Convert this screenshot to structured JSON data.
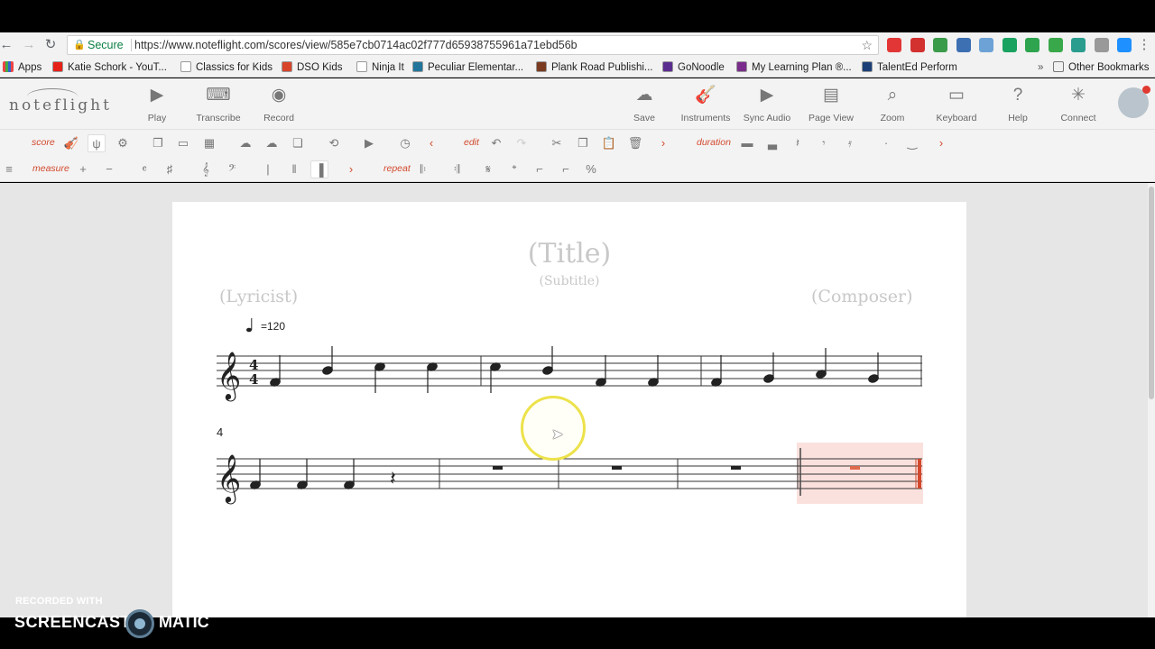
{
  "browser": {
    "secure_label": "Secure",
    "url": "https://www.noteflight.com/scores/view/585e7cb0714ac02f777d65938755961a71ebd56b",
    "apps_label": "Apps",
    "other_bookmarks": "Other Bookmarks",
    "overflow": "»",
    "bookmarks": [
      {
        "label": "Katie Schork - YouT...",
        "color": "#e62117"
      },
      {
        "label": "Classics for Kids",
        "color": "#ffffff"
      },
      {
        "label": "DSO Kids",
        "color": "#d8442a"
      },
      {
        "label": "Ninja It",
        "color": "#ffffff"
      },
      {
        "label": "Peculiar Elementar...",
        "color": "#21759b"
      },
      {
        "label": "Plank Road Publishi...",
        "color": "#7a3b20"
      },
      {
        "label": "GoNoodle",
        "color": "#5b2d8e"
      },
      {
        "label": "My Learning Plan ®...",
        "color": "#7a2c8c"
      },
      {
        "label": "TalentEd Perform",
        "color": "#1c3f77"
      }
    ],
    "extensions": [
      "#e23636",
      "#d33030",
      "#3a9b4a",
      "#3d6fb3",
      "#6da2d6",
      "#1aa260",
      "#2ea44f",
      "#38a84a",
      "#2a9d8f",
      "#999999",
      "#1e90ff"
    ]
  },
  "app": {
    "logo": "noteflight",
    "header_buttons": [
      {
        "label": "Play",
        "icon": "play-icon",
        "glyph": "▶"
      },
      {
        "label": "Transcribe",
        "icon": "keyboard-transcribe-icon",
        "glyph": "⌨"
      },
      {
        "label": "Record",
        "icon": "record-icon",
        "glyph": "◉"
      },
      {
        "label": "Save",
        "icon": "cloud-save-icon",
        "glyph": "☁"
      },
      {
        "label": "Instruments",
        "icon": "guitar-icon",
        "glyph": "🎸"
      },
      {
        "label": "Sync Audio",
        "icon": "sync-audio-icon",
        "glyph": "▶"
      },
      {
        "label": "Page View",
        "icon": "page-icon",
        "glyph": "▤"
      },
      {
        "label": "Zoom",
        "icon": "zoom-icon",
        "glyph": "⌕"
      },
      {
        "label": "Keyboard",
        "icon": "keyboard-icon",
        "glyph": "▭"
      },
      {
        "label": "Help",
        "icon": "help-icon",
        "glyph": "?"
      },
      {
        "label": "Connect",
        "icon": "connect-icon",
        "glyph": "✳"
      }
    ]
  },
  "toolbar": {
    "score_label": "score",
    "edit_label": "edit",
    "duration_label": "duration",
    "measure_label": "measure",
    "repeat_label": "repeat"
  },
  "score": {
    "title": "(Title)",
    "subtitle": "(Subtitle)",
    "lyricist": "(Lyricist)",
    "composer": "(Composer)",
    "tempo": "=120",
    "time_signature": "4/4",
    "second_system_measure_number": "4"
  },
  "recording": {
    "line1": "RECORDED WITH",
    "brand_left": "SCREENCAST",
    "brand_right": "MATIC"
  }
}
